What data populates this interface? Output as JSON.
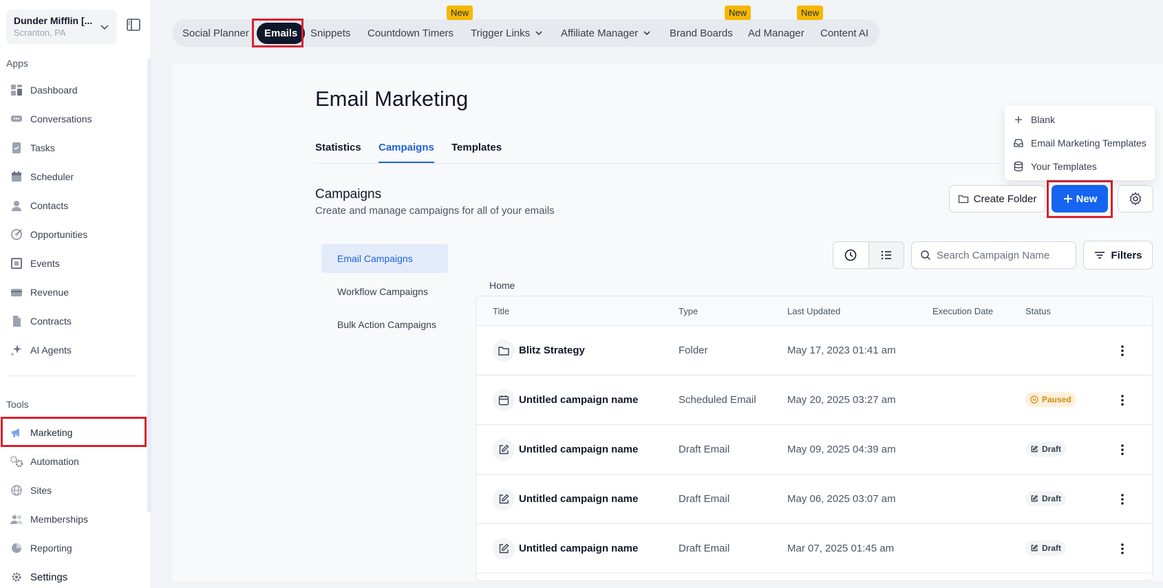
{
  "account": {
    "name": "Dunder Mifflin [...",
    "location": "Scranton, PA"
  },
  "sidebar": {
    "apps_label": "Apps",
    "tools_label": "Tools",
    "apps": [
      {
        "label": "Dashboard",
        "icon": "dashboard-icon"
      },
      {
        "label": "Conversations",
        "icon": "chat-icon"
      },
      {
        "label": "Tasks",
        "icon": "tasks-icon"
      },
      {
        "label": "Scheduler",
        "icon": "calendar-icon"
      },
      {
        "label": "Contacts",
        "icon": "user-icon"
      },
      {
        "label": "Opportunities",
        "icon": "target-icon"
      },
      {
        "label": "Events",
        "icon": "events-icon"
      },
      {
        "label": "Revenue",
        "icon": "credit-card-icon"
      },
      {
        "label": "Contracts",
        "icon": "document-icon"
      },
      {
        "label": "AI Agents",
        "icon": "sparkle-icon"
      }
    ],
    "tools": [
      {
        "label": "Marketing",
        "icon": "megaphone-icon"
      },
      {
        "label": "Automation",
        "icon": "gears-icon"
      },
      {
        "label": "Sites",
        "icon": "globe-icon"
      },
      {
        "label": "Memberships",
        "icon": "users-icon"
      },
      {
        "label": "Reporting",
        "icon": "pie-chart-icon"
      },
      {
        "label": "Settings",
        "icon": "gear-icon"
      }
    ]
  },
  "topnav": {
    "items": [
      {
        "label": "Social Planner"
      },
      {
        "label": "Emails"
      },
      {
        "label": "Snippets"
      },
      {
        "label": "Countdown Timers"
      },
      {
        "label": "Trigger Links"
      },
      {
        "label": "Affiliate Manager"
      },
      {
        "label": "Brand Boards"
      },
      {
        "label": "Ad Manager"
      },
      {
        "label": "Content AI"
      }
    ],
    "new_badge": "New"
  },
  "page": {
    "title": "Email Marketing",
    "tabs": [
      "Statistics",
      "Campaigns",
      "Templates"
    ],
    "section_title": "Campaigns",
    "section_subtitle": "Create and manage campaigns for all of your emails",
    "create_folder": "Create Folder",
    "new_button": "New",
    "filters_button": "Filters",
    "search_placeholder": "Search Campaign Name",
    "breadcrumb": "Home"
  },
  "new_menu": [
    "Blank",
    "Email Marketing Templates",
    "Your Templates"
  ],
  "campaign_tabs": [
    "Email Campaigns",
    "Workflow Campaigns",
    "Bulk Action Campaigns"
  ],
  "table": {
    "columns": [
      "Title",
      "Type",
      "Last Updated",
      "Execution Date",
      "Status"
    ],
    "rows": [
      {
        "title": "Blitz Strategy",
        "type": "Folder",
        "updated": "May 17, 2023 01:41 am",
        "status": "",
        "icon": "folder-icon"
      },
      {
        "title": "Untitled campaign name",
        "type": "Scheduled Email",
        "updated": "May 20, 2025 03:27 am",
        "status": "Paused",
        "icon": "calendar-icon"
      },
      {
        "title": "Untitled campaign name",
        "type": "Draft Email",
        "updated": "May 09, 2025 04:39 am",
        "status": "Draft",
        "icon": "edit-icon"
      },
      {
        "title": "Untitled campaign name",
        "type": "Draft Email",
        "updated": "May 06, 2025 03:07 am",
        "status": "Draft",
        "icon": "edit-icon"
      },
      {
        "title": "Untitled campaign name",
        "type": "Draft Email",
        "updated": "Mar 07, 2025 01:45 am",
        "status": "Draft",
        "icon": "edit-icon"
      }
    ]
  },
  "colors": {
    "primary": "#1565f0",
    "highlight": "#d9202e",
    "badge": "#f5b800",
    "active_pill": "#0f172a"
  }
}
